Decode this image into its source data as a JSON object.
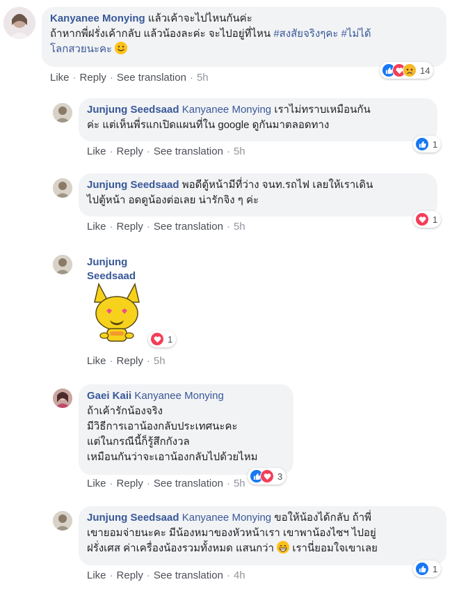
{
  "comments": [
    {
      "author": "Kanyanee Monying",
      "mention": "",
      "text_line1": "แล้วเค้าจะไปไหนกันค่ะ",
      "text_line2_pre": "ถ้าหากพี่ฝรั่งเค้ากลับ แล้วน้องละค่ะ จะไปอยู่ที่ไหน ",
      "hashtag1": "#สงสัยจริงๆคะ",
      "hashtag2": "#ไม่ได้",
      "text_line3": "โลกสวยนะคะ",
      "like_label": "Like",
      "reply_label": "Reply",
      "translate_label": "See translation",
      "time": "5h",
      "reaction_count": "14"
    },
    {
      "author": "Junjung Seedsaad",
      "mention": "Kanyanee Monying",
      "text_line1": "เราไม่ทราบเหมือนกัน",
      "text_line2": "ค่ะ แต่เห็นพี่รแกเปิดแผนที่ใน google ดูกันมาตลอดทาง",
      "like_label": "Like",
      "reply_label": "Reply",
      "translate_label": "See translation",
      "time": "5h",
      "reaction_count": "1"
    },
    {
      "author": "Junjung Seedsaad",
      "text_line1": "พอดีตู้หน้ามีที่ว่าง จนท.รถไฟ เลยให้เราเดิน",
      "text_line2": "ไปตู้หน้า อดดูน้องต่อเลย น่ารักจิง ๆ ค่ะ",
      "like_label": "Like",
      "reply_label": "Reply",
      "translate_label": "See translation",
      "time": "5h",
      "reaction_count": "1"
    },
    {
      "author": "Junjung Seedsaad",
      "like_label": "Like",
      "reply_label": "Reply",
      "time": "5h",
      "reaction_count": "1"
    },
    {
      "author": "Gaei Kaii",
      "mention": "Kanyanee Monying",
      "text_line1": "ถ้าเค้ารักน้องจริง",
      "text_line2": "มีวิธีการเอาน้องกลับประเทศนะคะ",
      "text_line3": "แต่ในกรณีนี้ก็รู้สึกกังวล",
      "text_line4": "เหมือนกันว่าจะเอาน้องกลับไปด้วยไหม",
      "like_label": "Like",
      "reply_label": "Reply",
      "translate_label": "See translation",
      "time": "5h",
      "reaction_count": "3"
    },
    {
      "author": "Junjung Seedsaad",
      "mention": "Kanyanee Monying",
      "text_line1": "ขอให้น้องได้กลับ ถ้าพี่",
      "text_line2": "เขายอมจ่ายนะคะ มีน้องหมาของหัวหน้าเรา เขาพาน้องไซฯ ไปอยู่",
      "text_line3_pre": "ฝรั่งเศส ค่าเครื่องน้องรวมทั้งหมด แสนกว่า",
      "text_line3_post": "เรานี่ยอมใจเขาเลย",
      "like_label": "Like",
      "reply_label": "Reply",
      "translate_label": "See translation",
      "time": "4h",
      "reaction_count": "1"
    }
  ],
  "colors": {
    "link": "#385898",
    "bubble": "#f2f3f5",
    "like": "#1877f2",
    "love": "#f33e58",
    "sad": "#f7b928"
  },
  "icons": [
    "like-icon",
    "love-icon",
    "sad-icon",
    "smile-emoji-icon",
    "grin-emoji-icon"
  ]
}
